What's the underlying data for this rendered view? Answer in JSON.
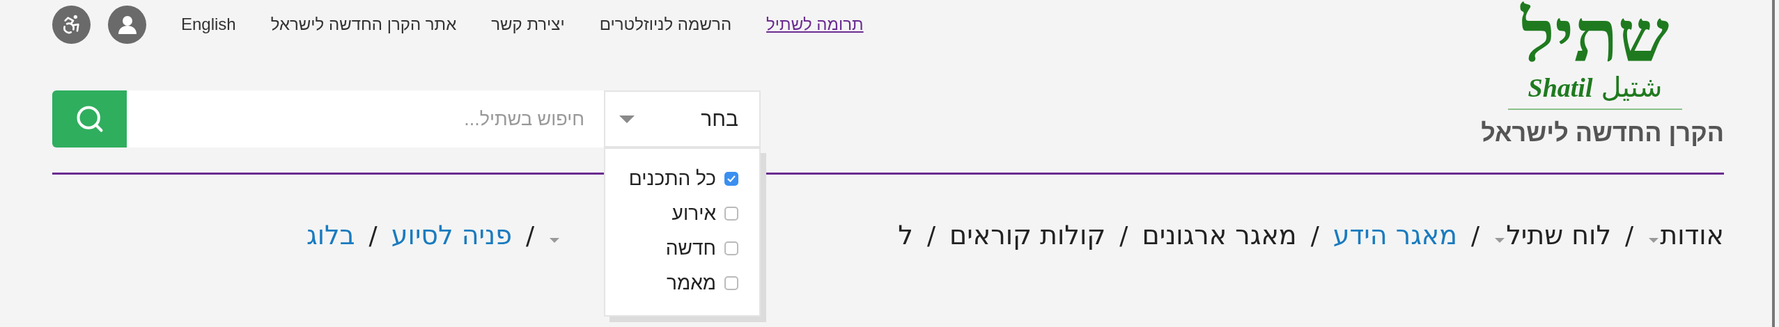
{
  "top_links": [
    {
      "label": "תרומה לשתיל",
      "kind": "donate"
    },
    {
      "label": "הרשמה לניוזלטרים",
      "kind": "plain"
    },
    {
      "label": "יצירת קשר",
      "kind": "plain"
    },
    {
      "label": "אתר הקרן החדשה לישראל",
      "kind": "plain"
    },
    {
      "label": "English",
      "kind": "plain"
    }
  ],
  "logo": {
    "hebrew": "שתיל",
    "latin": "Shatil",
    "arabic": "شتيل",
    "tagline": "הקרן החדשה לישראל"
  },
  "search": {
    "select_value": "בחר",
    "placeholder": "חיפוש בשתיל...",
    "dropdown_open": true,
    "options": [
      {
        "label": "כל התכנים",
        "checked": true
      },
      {
        "label": "אירוע",
        "checked": false
      },
      {
        "label": "חדשה",
        "checked": false
      },
      {
        "label": "מאמר",
        "checked": false
      }
    ]
  },
  "nav": [
    {
      "label": "אודות",
      "kind": "plain",
      "submenu": true,
      "separator": "/"
    },
    {
      "label": "לוח שתיל",
      "kind": "plain",
      "submenu": true,
      "separator": "/"
    },
    {
      "label": "מאגר הידע",
      "kind": "link",
      "submenu": false,
      "separator": "/"
    },
    {
      "label": "מאגר ארגונים",
      "kind": "plain",
      "submenu": false,
      "separator": "/"
    },
    {
      "label": "קולות קוראים",
      "kind": "plain",
      "submenu": false,
      "separator": "/"
    },
    {
      "label": "ל",
      "kind": "plain",
      "submenu": false
    },
    {
      "kind": "covered",
      "submenu": true,
      "separator": "/"
    },
    {
      "label": "פניה לסיוע",
      "kind": "link",
      "submenu": false,
      "separator": "/"
    },
    {
      "label": "בלוג",
      "kind": "link",
      "submenu": false
    }
  ]
}
